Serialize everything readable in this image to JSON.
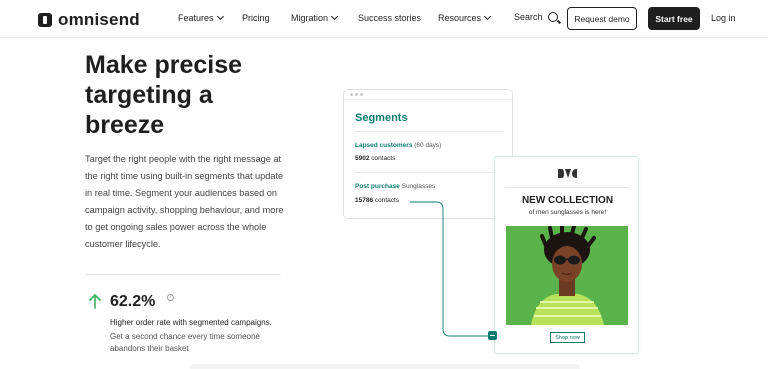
{
  "nav": {
    "logo": "omnisend",
    "items": [
      {
        "label": "Features",
        "dropdown": true
      },
      {
        "label": "Pricing",
        "dropdown": false
      },
      {
        "label": "Migration",
        "dropdown": true
      },
      {
        "label": "Success stories",
        "dropdown": false
      },
      {
        "label": "Resources",
        "dropdown": true
      }
    ],
    "search_label": "Search",
    "request_demo": "Request demo",
    "start_free": "Start free",
    "login": "Log in"
  },
  "hero": {
    "title": "Make precise targeting a breeze",
    "description": "Target the right people with the right message at the right time using built-in segments that update in real time. Segment your audiences based on campaign activity, shopping behaviour, and more to get ongoing sales power across the whole customer lifecycle."
  },
  "stat": {
    "value": "62.2%",
    "info_symbol": "i",
    "title": "Higher order rate with segmented campaigns.",
    "description": "Get a second chance every time someone abandons their basket"
  },
  "segments_card": {
    "title": "Segments",
    "segments": [
      {
        "name": "Lapsed customers",
        "note": "(60 days)",
        "count": "5902",
        "count_label": "contacts"
      },
      {
        "name": "Post purchase",
        "note": "Sunglasses",
        "count": "15786",
        "count_label": "contacts"
      }
    ]
  },
  "email_card": {
    "headline": "NEW COLLECTION",
    "subline": "of men sunglasses is here!",
    "button": "Shop now"
  },
  "colors": {
    "brand_dark": "#1f1f1f",
    "accent_teal": "#0b7d6e",
    "photo_green": "#58b04a"
  }
}
